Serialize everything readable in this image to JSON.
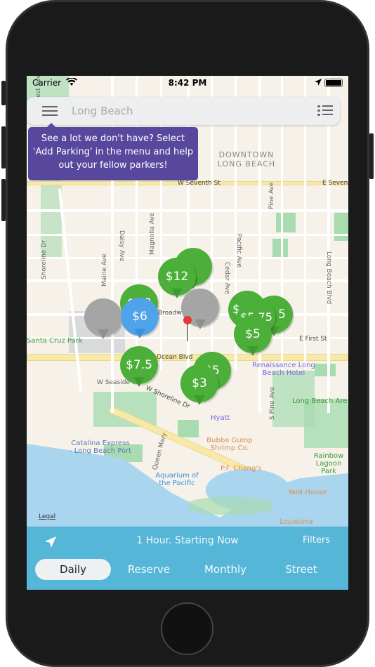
{
  "status_bar": {
    "carrier": "Carrier",
    "time": "8:42 PM"
  },
  "search": {
    "placeholder": "Long Beach",
    "menu_icon": "hamburger-menu-icon",
    "list_icon": "list-icon"
  },
  "tooltip": {
    "text": "See a lot we don't have? Select 'Add Parking' in the menu and help out your fellow parkers!",
    "color": "#57479d"
  },
  "map": {
    "labels": {
      "district": "DOWNTOWN LONG BEACH",
      "seventh": "W Seventh St",
      "seventh_e": "E Seven",
      "broadway": "Broadw",
      "ocean": "Ocean Blvd",
      "first": "E First St",
      "seaside": "W Seaside W",
      "shoreline": "W Shoreline Dr",
      "shoreline_dr": "Shoreline Dr",
      "maine": "Maine Ave",
      "daisy": "Daisy Ave",
      "magnolia": "Magnolia Ave",
      "cedar": "Cedar Ave",
      "pacific": "Pacific Ave",
      "pine": "Pine Ave",
      "spine": "S Pine Ave",
      "longbeach": "Long Beach Blvd",
      "deforest": "De Forest Ave",
      "queenmary": "Queen Mary",
      "santacruz": "Santa Cruz Park",
      "legal": "Legal"
    },
    "pois": {
      "renaissance": "Renaissance Long Beach Hotel",
      "hyatt": "Hyatt",
      "bubba": "Bubba Gump Shrimp Co.",
      "pfchang": "P.F. Chang's",
      "catalina": "Catalina Express - Long Beach Port",
      "aquarium": "Aquarium of the Pacific",
      "yardhouse": "Yard House",
      "louisiana": "Louisiana Charlie's",
      "arena": "Long Beach Are",
      "rainbow": "Rainbow Lagoon Park"
    },
    "markers": [
      {
        "price": "",
        "color": "green"
      },
      {
        "price": "$12",
        "color": "green"
      },
      {
        "price": "$?.?",
        "color": "green"
      },
      {
        "price": "",
        "color": "gray"
      },
      {
        "price": "$6",
        "color": "blue"
      },
      {
        "price": "",
        "color": "gray"
      },
      {
        "price": "$",
        "color": "green"
      },
      {
        "price": "5",
        "color": "green"
      },
      {
        "price": "$5.75",
        "color": "green"
      },
      {
        "price": "$5",
        "color": "green"
      },
      {
        "price": "$7.5",
        "color": "green"
      },
      {
        "price": "$5",
        "color": "green"
      },
      {
        "price": "$3",
        "color": "green"
      }
    ]
  },
  "bottom_bar": {
    "duration": "1 Hour. Starting Now",
    "filters": "Filters",
    "location_icon": "location-arrow-icon",
    "color": "#55b6d7",
    "tabs": [
      {
        "label": "Daily",
        "active": true
      },
      {
        "label": "Reserve"
      },
      {
        "label": "Monthly"
      },
      {
        "label": "Street"
      }
    ]
  }
}
